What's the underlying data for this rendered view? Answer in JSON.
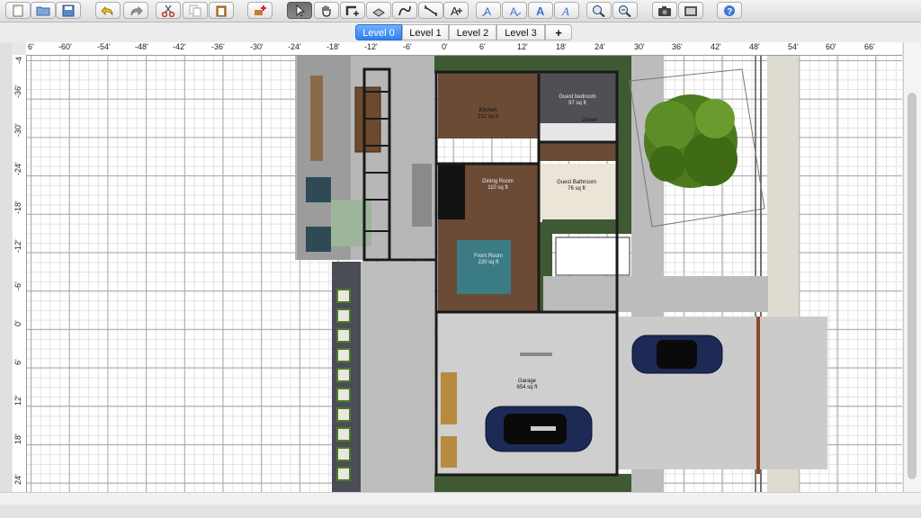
{
  "toolbar": {
    "buttons": [
      {
        "name": "new-home-button",
        "icon": "new-document-icon"
      },
      {
        "name": "open-button",
        "icon": "folder-icon"
      },
      {
        "name": "save-button",
        "icon": "save-icon"
      },
      {
        "name": "undo-button",
        "icon": "undo-icon"
      },
      {
        "name": "redo-button",
        "icon": "redo-icon"
      },
      {
        "name": "cut-button",
        "icon": "scissors-icon"
      },
      {
        "name": "copy-button",
        "icon": "copy-icon"
      },
      {
        "name": "paste-button",
        "icon": "paste-icon"
      },
      {
        "name": "add-furniture-button",
        "icon": "add-furniture-icon"
      },
      {
        "name": "select-mode-button",
        "icon": "arrow-cursor-icon",
        "active": true
      },
      {
        "name": "pan-mode-button",
        "icon": "hand-icon"
      },
      {
        "name": "create-walls-button",
        "icon": "wall-icon"
      },
      {
        "name": "create-rooms-button",
        "icon": "room-icon"
      },
      {
        "name": "create-polylines-button",
        "icon": "polyline-icon"
      },
      {
        "name": "create-dimensions-button",
        "icon": "dimension-icon"
      },
      {
        "name": "add-text-button",
        "icon": "text-icon"
      },
      {
        "name": "text-style-1-button",
        "icon": "text-style-icon"
      },
      {
        "name": "text-style-2-button",
        "icon": "text-style-icon"
      },
      {
        "name": "bold-text-button",
        "icon": "bold-icon"
      },
      {
        "name": "italic-text-button",
        "icon": "italic-icon"
      },
      {
        "name": "zoom-in-button",
        "icon": "zoom-in-icon"
      },
      {
        "name": "zoom-out-button",
        "icon": "zoom-out-icon"
      },
      {
        "name": "create-photo-button",
        "icon": "camera-icon"
      },
      {
        "name": "create-video-button",
        "icon": "video-icon"
      },
      {
        "name": "help-button",
        "icon": "help-icon"
      }
    ]
  },
  "levels": {
    "tabs": [
      "Level 0",
      "Level 1",
      "Level 2",
      "Level 3"
    ],
    "selected": "Level 0",
    "add_label": "+"
  },
  "rulers": {
    "horizontal": [
      "6'",
      "-60'",
      "-54'",
      "-48'",
      "-42'",
      "-36'",
      "-30'",
      "-24'",
      "-18'",
      "-12'",
      "-6'",
      "0'",
      "6'",
      "12'",
      "18'",
      "24'",
      "30'",
      "36'",
      "42'",
      "48'",
      "54'",
      "60'",
      "66'"
    ],
    "vertical": [
      "-4",
      "-36'",
      "-30'",
      "-24'",
      "-18'",
      "-12'",
      "-6'",
      "0'",
      "6'",
      "12'",
      "18'",
      "24'"
    ]
  },
  "rooms": [
    {
      "name": "Kitchen",
      "area": "212 sq ft"
    },
    {
      "name": "Guest bedroom",
      "area": "97 sq ft"
    },
    {
      "name": "Closet",
      "area": ""
    },
    {
      "name": "Dining Room",
      "area": "110 sq ft"
    },
    {
      "name": "Guest Bathroom",
      "area": "76 sq ft"
    },
    {
      "name": "Front Room",
      "area": "220 sq ft"
    },
    {
      "name": "Garage",
      "area": "654 sq ft"
    }
  ],
  "colors": {
    "tab_selected": "#2f7fee",
    "grid_major": "#a8a8a8",
    "grid_minor": "#e2e2e2",
    "wall": "#1a1a1a",
    "floor_wood": "#6b4a36",
    "concrete": "#c8c8c8",
    "car": "#1c2a55",
    "tree": "#4e7a1f"
  }
}
